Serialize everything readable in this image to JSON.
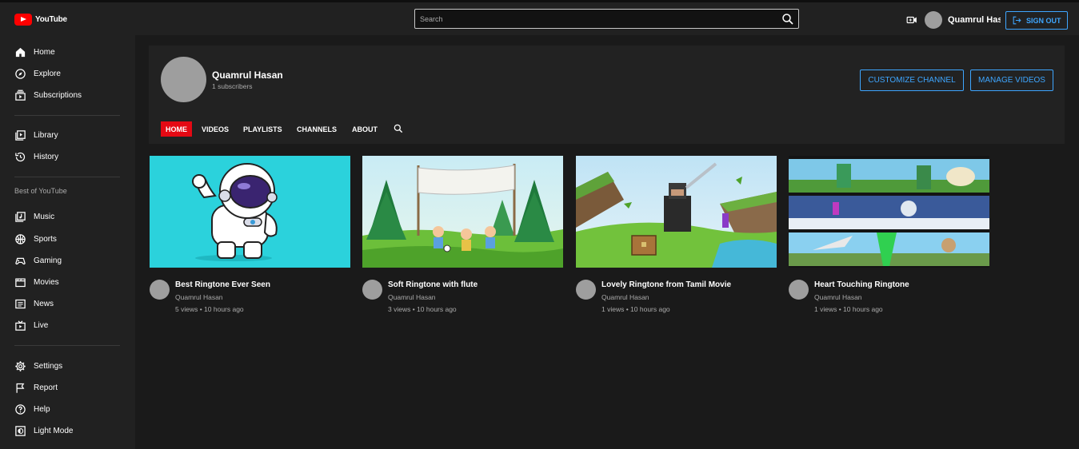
{
  "header": {
    "logo_text": "YouTube",
    "search_placeholder": "Search",
    "username": "Quamrul Has",
    "signout_label": "SIGN OUT"
  },
  "sidebar": {
    "items": [
      {
        "label": "Home",
        "icon": "home-icon"
      },
      {
        "label": "Explore",
        "icon": "compass-icon"
      },
      {
        "label": "Subscriptions",
        "icon": "subscriptions-icon"
      },
      {
        "label": "Library",
        "icon": "library-icon"
      },
      {
        "label": "History",
        "icon": "history-icon"
      },
      {
        "label": "Music",
        "icon": "music-icon"
      },
      {
        "label": "Sports",
        "icon": "sports-icon"
      },
      {
        "label": "Gaming",
        "icon": "gaming-icon"
      },
      {
        "label": "Movies",
        "icon": "movies-icon"
      },
      {
        "label": "News",
        "icon": "news-icon"
      },
      {
        "label": "Live",
        "icon": "live-icon"
      },
      {
        "label": "Settings",
        "icon": "gear-icon"
      },
      {
        "label": "Report",
        "icon": "flag-icon"
      },
      {
        "label": "Help",
        "icon": "help-icon"
      },
      {
        "label": "Light Mode",
        "icon": "light-mode-icon"
      }
    ],
    "section_title": "Best of YouTube"
  },
  "channel": {
    "name": "Quamrul Hasan",
    "subscribers": "1 subscribers",
    "customize_label": "CUSTOMIZE CHANNEL",
    "manage_label": "MANAGE VIDEOS",
    "tabs": [
      "HOME",
      "VIDEOS",
      "PLAYLISTS",
      "CHANNELS",
      "ABOUT"
    ]
  },
  "videos": [
    {
      "title": "Best Ringtone Ever Seen",
      "channel": "Quamrul Hasan",
      "meta": "5 views • 10 hours ago"
    },
    {
      "title": "Soft Ringtone with flute",
      "channel": "Quamrul Hasan",
      "meta": "3 views • 10 hours ago"
    },
    {
      "title": "Lovely Ringtone from Tamil Movie",
      "channel": "Quamrul Hasan",
      "meta": "1 views • 10 hours ago"
    },
    {
      "title": "Heart Touching Ringtone",
      "channel": "Quamrul Hasan",
      "meta": "1 views • 10 hours ago"
    }
  ],
  "colors": {
    "accent": "#3ea6ff",
    "active_tab": "#e50914",
    "brand": "#ff0000"
  }
}
